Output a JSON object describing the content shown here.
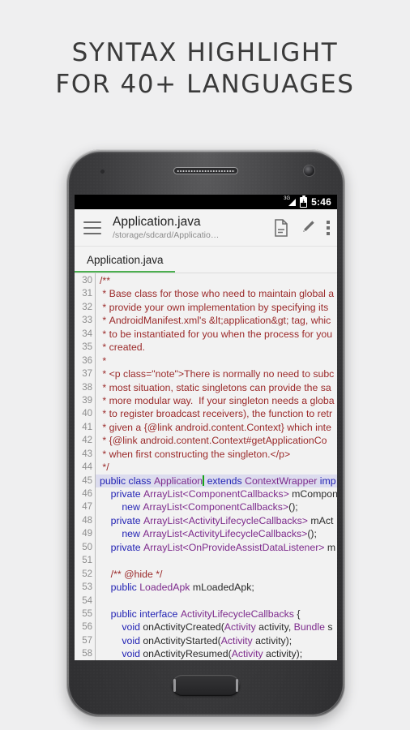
{
  "headline": {
    "line1": "SYNTAX HIGHLIGHT",
    "line2": "FOR 40+ LANGUAGES"
  },
  "colors": {
    "page_background": "#efeff0",
    "screen_background": "#f2f2f2",
    "tab_indicator": "#4caf50",
    "comment": "#9b2a2a",
    "keyword": "#2222b4",
    "type": "#7d2a8c",
    "plain": "#2b2b2b",
    "current_line_highlight": "#dcdcee",
    "cursor": "#16a316",
    "gutter_text": "#8e8e8e"
  },
  "statusbar": {
    "network_label": "3G",
    "signal_icon": "signal-bars-icon",
    "battery_icon": "battery-charging-icon",
    "time": "5:46"
  },
  "actionbar": {
    "menu_icon": "hamburger-menu-icon",
    "title": "Application.java",
    "subtitle": "/storage/sdcard/Applicatio…",
    "actions": [
      {
        "name": "document-icon",
        "label": "Document"
      },
      {
        "name": "edit-pencil-icon",
        "label": "Edit"
      },
      {
        "name": "overflow-menu-icon",
        "label": "More options"
      }
    ]
  },
  "tabs": [
    {
      "label": "Application.java",
      "active": true
    }
  ],
  "editor": {
    "first_line_number": 30,
    "current_line": 45,
    "line_numbers": [
      30,
      31,
      32,
      33,
      34,
      35,
      36,
      37,
      38,
      39,
      40,
      41,
      42,
      43,
      44,
      45,
      46,
      47,
      48,
      49,
      50,
      51,
      52,
      53,
      54,
      55,
      56,
      57,
      58
    ],
    "lines": [
      {
        "n": 30,
        "text": "/**",
        "tokens": [
          {
            "t": "/**",
            "c": "cmt"
          }
        ]
      },
      {
        "n": 31,
        "text": " * Base class for those who need to maintain global a",
        "tokens": [
          {
            "t": " * Base class for those who need to maintain global a",
            "c": "cmt"
          }
        ]
      },
      {
        "n": 32,
        "text": " * provide your own implementation by specifying its",
        "tokens": [
          {
            "t": " * provide your own implementation by specifying its",
            "c": "cmt"
          }
        ]
      },
      {
        "n": 33,
        "text": " * AndroidManifest.xml's &lt;application&gt; tag, whic",
        "tokens": [
          {
            "t": " * AndroidManifest.xml's &lt;application&gt; tag, whic",
            "c": "cmt"
          }
        ]
      },
      {
        "n": 34,
        "text": " * to be instantiated for you when the process for you",
        "tokens": [
          {
            "t": " * to be instantiated for you when the process for you",
            "c": "cmt"
          }
        ]
      },
      {
        "n": 35,
        "text": " * created.",
        "tokens": [
          {
            "t": " * created.",
            "c": "cmt"
          }
        ]
      },
      {
        "n": 36,
        "text": " *",
        "tokens": [
          {
            "t": " *",
            "c": "cmt"
          }
        ]
      },
      {
        "n": 37,
        "text": " * <p class=\"note\">There is normally no need to subc",
        "tokens": [
          {
            "t": " * <p class=\"note\">There is normally no need to subc",
            "c": "cmt"
          }
        ]
      },
      {
        "n": 38,
        "text": " * most situation, static singletons can provide the sa",
        "tokens": [
          {
            "t": " * most situation, static singletons can provide the sa",
            "c": "cmt"
          }
        ]
      },
      {
        "n": 39,
        "text": " * more modular way.  If your singleton needs a globa",
        "tokens": [
          {
            "t": " * more modular way.  If your singleton needs a globa",
            "c": "cmt"
          }
        ]
      },
      {
        "n": 40,
        "text": " * to register broadcast receivers), the function to retr",
        "tokens": [
          {
            "t": " * to register broadcast receivers), the function to retr",
            "c": "cmt"
          }
        ]
      },
      {
        "n": 41,
        "text": " * given a {@link android.content.Context} which inte",
        "tokens": [
          {
            "t": " * given a {@link android.content.Context} which inte",
            "c": "cmt"
          }
        ]
      },
      {
        "n": 42,
        "text": " * {@link android.content.Context#getApplicationCo",
        "tokens": [
          {
            "t": " * {@link android.content.Context#getApplicationCo",
            "c": "cmt"
          }
        ]
      },
      {
        "n": 43,
        "text": " * when first constructing the singleton.</p>",
        "tokens": [
          {
            "t": " * when first constructing the singleton.</p>",
            "c": "cmt"
          }
        ]
      },
      {
        "n": 44,
        "text": " */",
        "tokens": [
          {
            "t": " */",
            "c": "cmt"
          }
        ]
      },
      {
        "n": 45,
        "text": "public class Application extends ContextWrapper imp",
        "current": true,
        "tokens": [
          {
            "t": "public class ",
            "c": "kw"
          },
          {
            "t": "Application",
            "c": "typ"
          },
          {
            "t": "|CURSOR|",
            "c": "cursor"
          },
          {
            "t": " extends ",
            "c": "kw"
          },
          {
            "t": "ContextWrapper",
            "c": "typ"
          },
          {
            "t": " imp",
            "c": "kw"
          }
        ]
      },
      {
        "n": 46,
        "text": "    private ArrayList<ComponentCallbacks> mCompon",
        "tokens": [
          {
            "t": "    ",
            "c": "pln"
          },
          {
            "t": "private ",
            "c": "kw"
          },
          {
            "t": "ArrayList<ComponentCallbacks>",
            "c": "typ"
          },
          {
            "t": " mCompon",
            "c": "pln"
          }
        ]
      },
      {
        "n": 47,
        "text": "        new ArrayList<ComponentCallbacks>();",
        "tokens": [
          {
            "t": "        ",
            "c": "pln"
          },
          {
            "t": "new ",
            "c": "kw"
          },
          {
            "t": "ArrayList<ComponentCallbacks>",
            "c": "typ"
          },
          {
            "t": "();",
            "c": "pln"
          }
        ]
      },
      {
        "n": 48,
        "text": "    private ArrayList<ActivityLifecycleCallbacks> mAct",
        "tokens": [
          {
            "t": "    ",
            "c": "pln"
          },
          {
            "t": "private ",
            "c": "kw"
          },
          {
            "t": "ArrayList<ActivityLifecycleCallbacks>",
            "c": "typ"
          },
          {
            "t": " mAct",
            "c": "pln"
          }
        ]
      },
      {
        "n": 49,
        "text": "        new ArrayList<ActivityLifecycleCallbacks>();",
        "tokens": [
          {
            "t": "        ",
            "c": "pln"
          },
          {
            "t": "new ",
            "c": "kw"
          },
          {
            "t": "ArrayList<ActivityLifecycleCallbacks>",
            "c": "typ"
          },
          {
            "t": "();",
            "c": "pln"
          }
        ]
      },
      {
        "n": 50,
        "text": "    private ArrayList<OnProvideAssistDataListener> m",
        "tokens": [
          {
            "t": "    ",
            "c": "pln"
          },
          {
            "t": "private ",
            "c": "kw"
          },
          {
            "t": "ArrayList<OnProvideAssistDataListener>",
            "c": "typ"
          },
          {
            "t": " m",
            "c": "pln"
          }
        ]
      },
      {
        "n": 51,
        "text": "",
        "tokens": []
      },
      {
        "n": 52,
        "text": "    /** @hide */",
        "tokens": [
          {
            "t": "    /** @hide */",
            "c": "cmt"
          }
        ]
      },
      {
        "n": 53,
        "text": "    public LoadedApk mLoadedApk;",
        "tokens": [
          {
            "t": "    ",
            "c": "pln"
          },
          {
            "t": "public ",
            "c": "kw"
          },
          {
            "t": "LoadedApk",
            "c": "typ"
          },
          {
            "t": " mLoadedApk;",
            "c": "pln"
          }
        ]
      },
      {
        "n": 54,
        "text": "",
        "tokens": []
      },
      {
        "n": 55,
        "text": "    public interface ActivityLifecycleCallbacks {",
        "tokens": [
          {
            "t": "    ",
            "c": "pln"
          },
          {
            "t": "public interface ",
            "c": "kw"
          },
          {
            "t": "ActivityLifecycleCallbacks",
            "c": "typ"
          },
          {
            "t": " {",
            "c": "pln"
          }
        ]
      },
      {
        "n": 56,
        "text": "        void onActivityCreated(Activity activity, Bundle s",
        "tokens": [
          {
            "t": "        ",
            "c": "pln"
          },
          {
            "t": "void ",
            "c": "kw"
          },
          {
            "t": "onActivityCreated(",
            "c": "pln"
          },
          {
            "t": "Activity",
            "c": "typ"
          },
          {
            "t": " activity, ",
            "c": "pln"
          },
          {
            "t": "Bundle",
            "c": "typ"
          },
          {
            "t": " s",
            "c": "pln"
          }
        ]
      },
      {
        "n": 57,
        "text": "        void onActivityStarted(Activity activity);",
        "tokens": [
          {
            "t": "        ",
            "c": "pln"
          },
          {
            "t": "void ",
            "c": "kw"
          },
          {
            "t": "onActivityStarted(",
            "c": "pln"
          },
          {
            "t": "Activity",
            "c": "typ"
          },
          {
            "t": " activity);",
            "c": "pln"
          }
        ]
      },
      {
        "n": 58,
        "text": "        void onActivityResumed(Activity activity);",
        "tokens": [
          {
            "t": "        ",
            "c": "pln"
          },
          {
            "t": "void ",
            "c": "kw"
          },
          {
            "t": "onActivityResumed(",
            "c": "pln"
          },
          {
            "t": "Activity",
            "c": "typ"
          },
          {
            "t": " activity);",
            "c": "pln"
          }
        ]
      }
    ]
  },
  "device": {
    "speaker_icon": "earpiece-speaker-icon",
    "camera_icon": "front-camera-icon",
    "home_button_label": "home-button"
  }
}
